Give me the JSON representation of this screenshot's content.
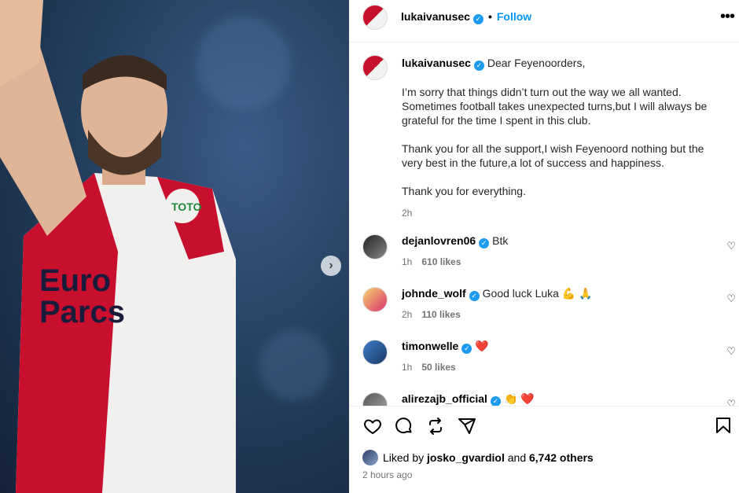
{
  "header": {
    "username": "lukaivanusec",
    "follow_label": "Follow",
    "dot": "•",
    "more": "•••"
  },
  "caption": {
    "username": "lukaivanusec",
    "greeting": "Dear Feyenoorders,",
    "para1": "I’m sorry that things didn’t turn out the way we all wanted. Sometimes football takes unexpected turns,but I will always be grateful for the time I spent in this club.",
    "para2": "Thank you for all the support,I wish Feyenoord nothing but the very best in the future,a lot of success and happiness.",
    "para3": "Thank you for everything.",
    "time": "2h"
  },
  "comments": [
    {
      "username": "dejanlovren06",
      "text": "Btk",
      "time": "1h",
      "likes": "610 likes"
    },
    {
      "username": "johnde_wolf",
      "text": "Good luck Luka 💪 🙏",
      "time": "2h",
      "likes": "110 likes"
    },
    {
      "username": "timonwelle",
      "text": "❤️",
      "time": "1h",
      "likes": "50 likes"
    },
    {
      "username": "alirezajb_official",
      "text": "👏 ❤️",
      "time": "",
      "likes": ""
    }
  ],
  "footer": {
    "liked_prefix": "Liked by",
    "liked_user": "josko_gvardiol",
    "liked_and": "and",
    "liked_others": "6,742 others",
    "posted": "2 hours ago"
  },
  "colors": {
    "accent": "#0095f6",
    "verified": "#1d9bf0",
    "jersey_red": "#c8102e"
  },
  "icons": [
    "carousel-next-icon",
    "verified-icon",
    "more-icon",
    "heart-icon",
    "comment-icon",
    "repost-icon",
    "share-icon",
    "bookmark-icon"
  ]
}
